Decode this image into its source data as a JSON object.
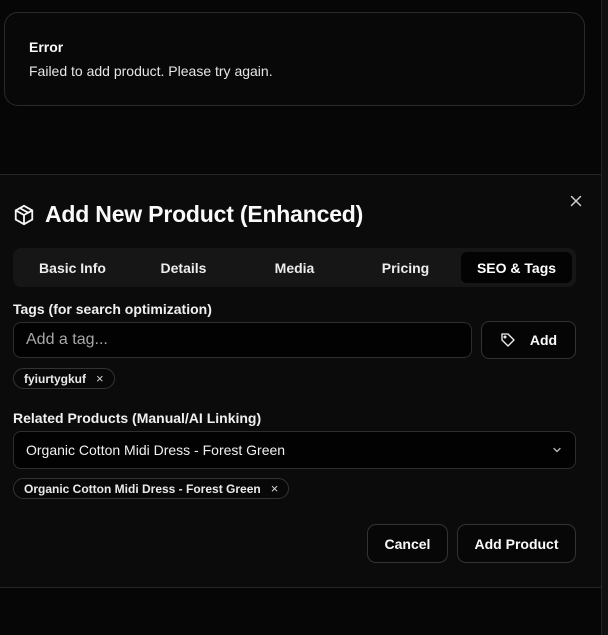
{
  "toast": {
    "title": "Error",
    "description": "Failed to add product. Please try again."
  },
  "dialog": {
    "title": "Add New Product (Enhanced)",
    "close_label": "×",
    "tabs": [
      {
        "label": "Basic Info",
        "active": false
      },
      {
        "label": "Details",
        "active": false
      },
      {
        "label": "Media",
        "active": false
      },
      {
        "label": "Pricing",
        "active": false
      },
      {
        "label": "SEO & Tags",
        "active": true
      }
    ],
    "tags": {
      "label": "Tags (for search optimization)",
      "input_value": "",
      "placeholder": "Add a tag...",
      "add_label": "Add",
      "chips": [
        "fyiurtygkuf"
      ]
    },
    "related": {
      "label": "Related Products (Manual/AI Linking)",
      "selected": "Organic Cotton Midi Dress - Forest Green",
      "chips": [
        "Organic Cotton Midi Dress - Forest Green"
      ]
    },
    "actions": {
      "cancel_label": "Cancel",
      "submit_label": "Add Product"
    }
  },
  "colors": {
    "background": "#060606",
    "dialog": "#0b0b0b",
    "tab_bar": "#161616",
    "border": "#2e2e2e",
    "text": "#f2f2f2"
  },
  "icons": [
    "package-icon",
    "tag-icon",
    "close-icon",
    "chevron-down-icon",
    "remove-chip-icon"
  ]
}
